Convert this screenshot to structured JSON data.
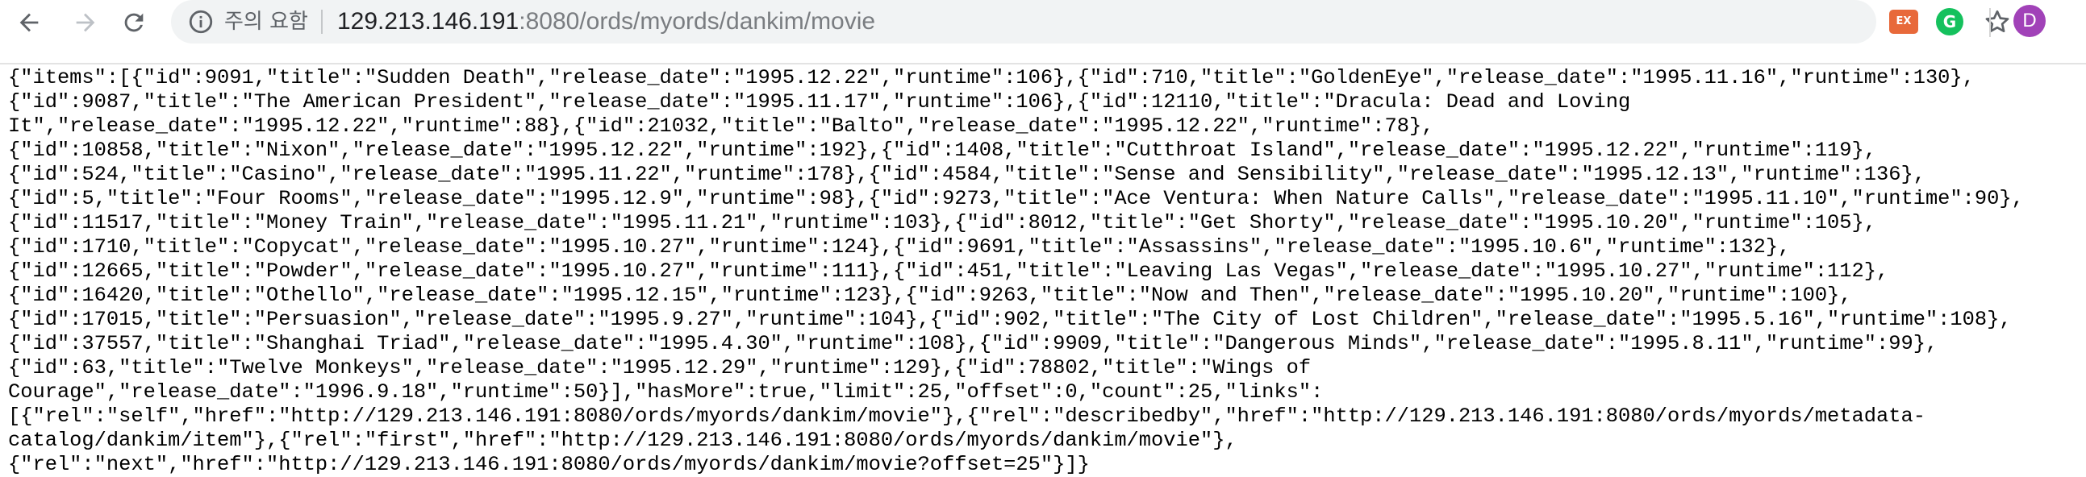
{
  "browser": {
    "security_label": "주의 요함",
    "url_host": "129.213.146.191",
    "url_rest": ":8080/ords/myords/dankim/movie",
    "extensions": [
      {
        "label": "EX",
        "color": "#e8693a"
      },
      {
        "label": "G",
        "color": "#15c15d"
      }
    ],
    "avatar_letter": "D",
    "avatar_color": "#a142b8"
  },
  "content": {
    "lines": [
      "{\"items\":[{\"id\":9091,\"title\":\"Sudden Death\",\"release_date\":\"1995.12.22\",\"runtime\":106},{\"id\":710,\"title\":\"GoldenEye\",\"release_date\":\"1995.11.16\",\"runtime\":130},",
      "{\"id\":9087,\"title\":\"The American President\",\"release_date\":\"1995.11.17\",\"runtime\":106},{\"id\":12110,\"title\":\"Dracula: Dead and Loving",
      "It\",\"release_date\":\"1995.12.22\",\"runtime\":88},{\"id\":21032,\"title\":\"Balto\",\"release_date\":\"1995.12.22\",\"runtime\":78},",
      "{\"id\":10858,\"title\":\"Nixon\",\"release_date\":\"1995.12.22\",\"runtime\":192},{\"id\":1408,\"title\":\"Cutthroat Island\",\"release_date\":\"1995.12.22\",\"runtime\":119},",
      "{\"id\":524,\"title\":\"Casino\",\"release_date\":\"1995.11.22\",\"runtime\":178},{\"id\":4584,\"title\":\"Sense and Sensibility\",\"release_date\":\"1995.12.13\",\"runtime\":136},",
      "{\"id\":5,\"title\":\"Four Rooms\",\"release_date\":\"1995.12.9\",\"runtime\":98},{\"id\":9273,\"title\":\"Ace Ventura: When Nature Calls\",\"release_date\":\"1995.11.10\",\"runtime\":90},",
      "{\"id\":11517,\"title\":\"Money Train\",\"release_date\":\"1995.11.21\",\"runtime\":103},{\"id\":8012,\"title\":\"Get Shorty\",\"release_date\":\"1995.10.20\",\"runtime\":105},",
      "{\"id\":1710,\"title\":\"Copycat\",\"release_date\":\"1995.10.27\",\"runtime\":124},{\"id\":9691,\"title\":\"Assassins\",\"release_date\":\"1995.10.6\",\"runtime\":132},",
      "{\"id\":12665,\"title\":\"Powder\",\"release_date\":\"1995.10.27\",\"runtime\":111},{\"id\":451,\"title\":\"Leaving Las Vegas\",\"release_date\":\"1995.10.27\",\"runtime\":112},",
      "{\"id\":16420,\"title\":\"Othello\",\"release_date\":\"1995.12.15\",\"runtime\":123},{\"id\":9263,\"title\":\"Now and Then\",\"release_date\":\"1995.10.20\",\"runtime\":100},",
      "{\"id\":17015,\"title\":\"Persuasion\",\"release_date\":\"1995.9.27\",\"runtime\":104},{\"id\":902,\"title\":\"The City of Lost Children\",\"release_date\":\"1995.5.16\",\"runtime\":108},",
      "{\"id\":37557,\"title\":\"Shanghai Triad\",\"release_date\":\"1995.4.30\",\"runtime\":108},{\"id\":9909,\"title\":\"Dangerous Minds\",\"release_date\":\"1995.8.11\",\"runtime\":99},",
      "{\"id\":63,\"title\":\"Twelve Monkeys\",\"release_date\":\"1995.12.29\",\"runtime\":129},{\"id\":78802,\"title\":\"Wings of",
      "Courage\",\"release_date\":\"1996.9.18\",\"runtime\":50}],\"hasMore\":true,\"limit\":25,\"offset\":0,\"count\":25,\"links\":",
      "[{\"rel\":\"self\",\"href\":\"http://129.213.146.191:8080/ords/myords/dankim/movie\"},{\"rel\":\"describedby\",\"href\":\"http://129.213.146.191:8080/ords/myords/metadata-",
      "catalog/dankim/item\"},{\"rel\":\"first\",\"href\":\"http://129.213.146.191:8080/ords/myords/dankim/movie\"},",
      "{\"rel\":\"next\",\"href\":\"http://129.213.146.191:8080/ords/myords/dankim/movie?offset=25\"}]}"
    ]
  }
}
